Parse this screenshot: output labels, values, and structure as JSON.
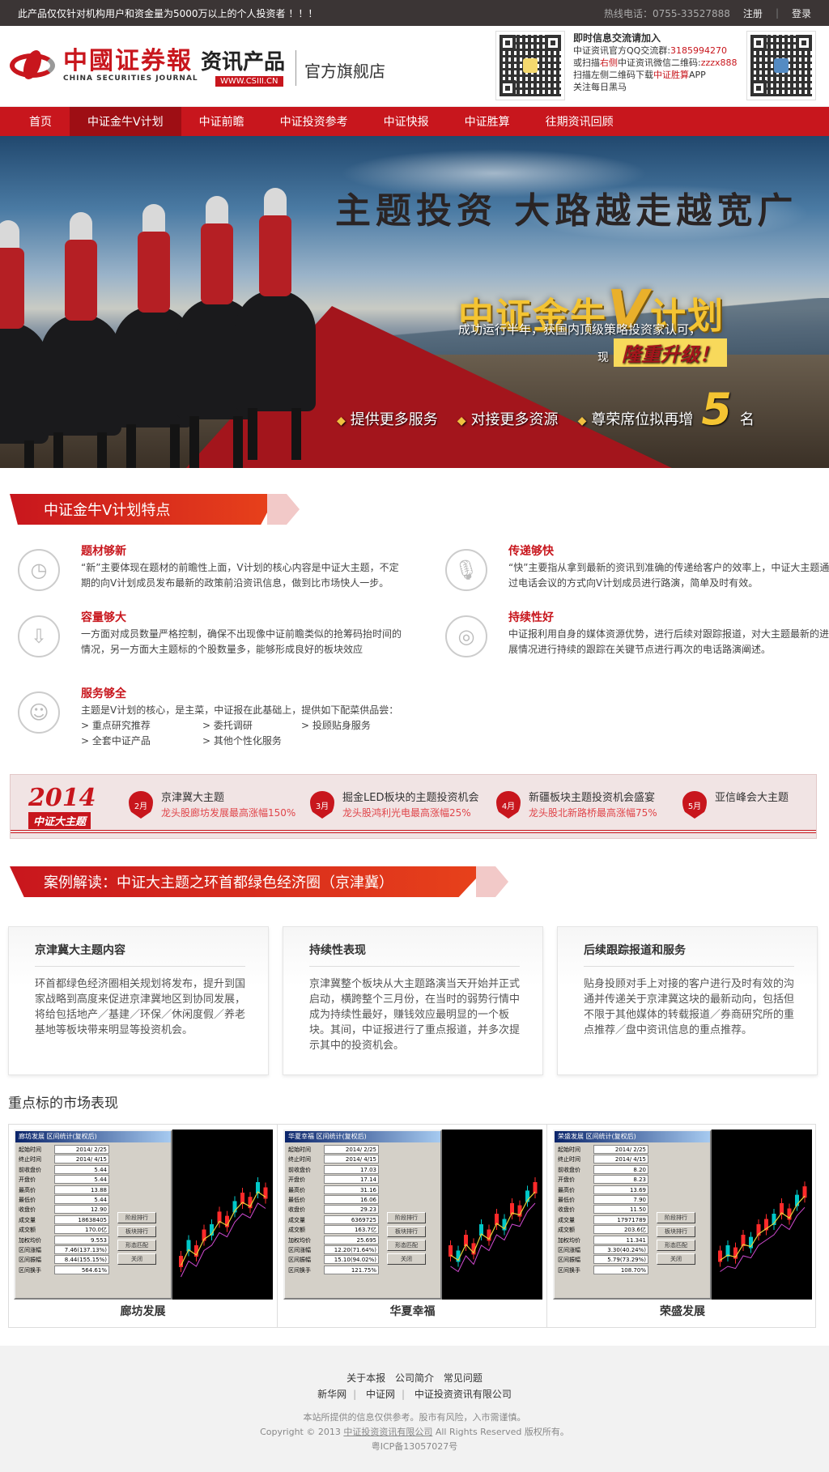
{
  "topbar": {
    "notice": "此产品仅仅针对机构用户和资金量为5000万以上的个人投资者 ！！！",
    "hotline": "热线电话：0755-33527888",
    "register": "注册",
    "divider": "|",
    "login": "登录"
  },
  "header": {
    "logo_cn": "中國证券報",
    "logo_en": "CHINA SECURITIES JOURNAL",
    "product": "资讯产品",
    "product_url": "WWW.CSIII.CN",
    "flagship": "官方旗舰店",
    "qr_info": {
      "line1": "即时信息交流请加入",
      "line2_label": "中证资讯官方QQ交流群:",
      "line2_value": "3185994270",
      "line3_a": "或扫描",
      "line3_red": "右侧",
      "line3_b": "中证资讯微信二维码:",
      "line3_value": "zzzx888",
      "line4_a": "扫描左侧二维码下载",
      "line4_red": "中证胜算",
      "line4_b": "APP",
      "line5": "关注每日黑马"
    }
  },
  "nav": {
    "items": [
      {
        "label": "首页",
        "active": false
      },
      {
        "label": "中证金牛V计划",
        "active": true
      },
      {
        "label": "中证前瞻",
        "active": false
      },
      {
        "label": "中证投资参考",
        "active": false
      },
      {
        "label": "中证快报",
        "active": false
      },
      {
        "label": "中证胜算",
        "active": false
      },
      {
        "label": "往期资讯回顾",
        "active": false
      }
    ]
  },
  "banner": {
    "headline": "主题投资  大路越走越宽广",
    "plan_prefix": "中证金牛",
    "plan_v": "V",
    "plan_suffix": "计划",
    "sub": "成功运行半年，获国内顶级策略投资家认可，",
    "up_prefix": "现",
    "up_big": "隆重升级！",
    "feature1": "提供更多服务",
    "feature2": "对接更多资源",
    "feature3_a": "尊荣席位拟再增",
    "feature3_num": "5",
    "feature3_b": "名"
  },
  "features_section": {
    "title": "中证金牛V计划特点",
    "items": [
      {
        "icon": "clock-icon",
        "title": "题材够新",
        "desc": "“新”主要体现在题材的前瞻性上面，V计划的核心内容是中证大主题，不定期的向V计划成员发布最新的政策前沿资讯信息，做到比市场快人一步。"
      },
      {
        "icon": "microphone-icon",
        "title": "传递够快",
        "desc": "“快”主要指从拿到最新的资讯到准确的传递给客户的效率上，中证大主题通过电话会议的方式向V计划成员进行路演，简单及时有效。"
      },
      {
        "icon": "download-icon",
        "title": "容量够大",
        "desc": "一方面对成员数量严格控制，确保不出现像中证前瞻类似的抢筹码抬时间的情况，另一方面大主题标的个股数量多，能够形成良好的板块效应"
      },
      {
        "icon": "signal-icon",
        "title": "持续性好",
        "desc": "中证报利用自身的媒体资源优势，进行后续对跟踪报道，对大主题最新的进展情况进行持续的跟踪在关键节点进行再次的电话路演阐述。"
      },
      {
        "icon": "user-icon",
        "title": "服务够全",
        "desc": "主题是V计划的核心，是主菜，中证报在此基础上，提供如下配菜供品尝："
      }
    ],
    "services": [
      "> 重点研究推荐",
      "> 委托调研",
      "> 投顾贴身服务",
      "> 全套中证产品",
      "> 其他个性化服务"
    ]
  },
  "timeline": {
    "year": "2014",
    "label": "中证大主题",
    "items": [
      {
        "month": "2月",
        "title": "京津冀大主题",
        "detail": "龙头股廊坊发展最高涨幅150%"
      },
      {
        "month": "3月",
        "title": "掘金LED板块的主题投资机会",
        "detail": "龙头股鸿利光电最高涨幅25%"
      },
      {
        "month": "4月",
        "title": "新疆板块主题投资机会盛宴",
        "detail": "龙头股北新路桥最高涨幅75%"
      },
      {
        "month": "5月",
        "title": "亚信峰会大主题",
        "detail": ""
      }
    ]
  },
  "case_section": {
    "title": "案例解读：中证大主题之环首都绿色经济圈（京津冀）",
    "cards": [
      {
        "title": "京津冀大主题内容",
        "body": "环首都绿色经济圈相关规划将发布，提升到国家战略到高度来促进京津冀地区到协同发展，将给包括地产／基建／环保／休闲度假／养老基地等板块带来明显等投资机会。"
      },
      {
        "title": "持续性表现",
        "body": "京津冀整个板块从大主题路演当天开始并正式启动，横跨整个三月份，在当时的弱势行情中成为持续性最好，赚钱效应最明显的一个板块。其间，中证报进行了重点报道，并多次提示其中的投资机会。"
      },
      {
        "title": "后续跟踪报道和服务",
        "body": "贴身投顾对手上对接的客户进行及时有效的沟通并传递关于京津冀这块的最新动向，包括但不限于其他媒体的转载报道／券商研究所的重点推荐／盘中资讯信息的重点推荐。"
      }
    ]
  },
  "performance": {
    "title": "重点标的市场表现",
    "panel_header": "区间统计(复权后)",
    "row_labels": [
      "起始时间",
      "终止时间",
      "前收盘价",
      "开盘价",
      "最高价",
      "最低价",
      "收盘价",
      "成交量",
      "成交额",
      "加权均价",
      "区间涨幅",
      "区间振幅",
      "区间换手"
    ],
    "buttons": [
      "阶段排行",
      "板块排行",
      "形态匹配",
      "关闭"
    ],
    "stocks": [
      {
        "name": "廊坊发展",
        "header": "廊坊发展",
        "values": [
          "2014/ 2/25",
          "2014/ 4/15",
          "5.44",
          "5.44",
          "13.88",
          "5.44",
          "12.90",
          "18638405",
          "170.0亿",
          "9.553",
          "7.46(137.13%)",
          "8.44(155.15%)",
          "564.61%"
        ]
      },
      {
        "name": "华夏幸福",
        "header": "华夏幸福",
        "values": [
          "2014/ 2/25",
          "2014/ 4/15",
          "17.03",
          "17.14",
          "31.16",
          "16.06",
          "29.23",
          "6369725",
          "163.7亿",
          "25.695",
          "12.20(71.64%)",
          "15.10(94.02%)",
          "121.75%"
        ]
      },
      {
        "name": "荣盛发展",
        "header": "荣盛发展",
        "values": [
          "2014/ 2/25",
          "2014/ 4/15",
          "8.20",
          "8.23",
          "13.69",
          "7.90",
          "11.50",
          "17971789",
          "203.6亿",
          "11.341",
          "3.30(40.24%)",
          "5.79(73.29%)",
          "108.70%"
        ]
      }
    ]
  },
  "footer": {
    "links1": [
      "关于本报",
      "公司简介",
      "常见问题"
    ],
    "links2": [
      "新华网",
      "中证网",
      "中证投资资讯有限公司"
    ],
    "disclaimer": "本站所提供的信息仅供参考。股市有风险，入市需谨慎。",
    "copyright_a": "Copyright © 2013 ",
    "copyright_link": "中证投资资讯有限公司",
    "copyright_b": " All Rights Reserved 版权所有。",
    "icp": "粤ICP备13057027号"
  }
}
